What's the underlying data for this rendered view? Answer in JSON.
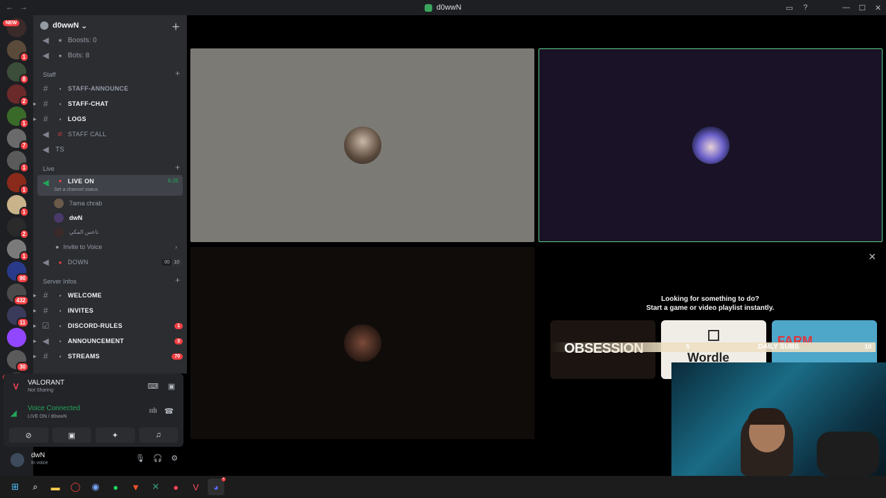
{
  "window": {
    "title": "d0wwN"
  },
  "guild_badges": [
    {
      "badge": "NEW",
      "new": true,
      "color": "#3a2a2a"
    },
    {
      "badge": "1",
      "color": "#5a4a3a"
    },
    {
      "badge": "8",
      "color": "#3c4d3a"
    },
    {
      "badge": "2",
      "color": "#6a2a2a"
    },
    {
      "badge": "1",
      "color": "#3a6a2a"
    },
    {
      "badge": "7",
      "color": "#6a6a6a"
    },
    {
      "badge": "1",
      "color": "#5a5a5a"
    },
    {
      "badge": "1",
      "color": "#8a2a1a"
    },
    {
      "badge": "1",
      "color": "#c9b38a"
    },
    {
      "badge": "2",
      "color": "#2a2a2a"
    },
    {
      "badge": "1",
      "color": "#7a7a7a"
    },
    {
      "badge": "90",
      "color": "#2a3a8a"
    },
    {
      "badge": "432",
      "color": "#4a4a4a"
    },
    {
      "badge": "11",
      "color": "#3a3a5a"
    },
    {
      "badge": "",
      "color": "#9146ff"
    },
    {
      "badge": "30",
      "color": "#5a5a5a"
    },
    {
      "badge": "NEW",
      "new": true,
      "color": "#3a3a3a"
    }
  ],
  "server": {
    "name": "d0wwN"
  },
  "channels": {
    "boosts": "Boosts: 0",
    "bots": "Bots: 8",
    "cat_staff": "Staff",
    "staff_announce": "STAFF-ANNOUNCE",
    "staff_chat": "STAFF-CHAT",
    "logs": "LOGS",
    "staff_call": "STAFF CALL",
    "ts": "TS",
    "cat_live": "Live",
    "live_on": "LIVE ON",
    "live_time": "6:35",
    "live_status": "Set a channel status",
    "user1": "7ama chrab",
    "user2": "dwN",
    "user3": "ناعس المكي",
    "invite": "Invite to Voice",
    "down": "DOWN",
    "down_limit_a": "00",
    "down_limit_b": "10",
    "cat_infos": "Server Infos",
    "welcome": "WELCOME",
    "invites": "INVITES",
    "rules": "DISCORD-RULES",
    "rules_count": "1",
    "announce": "ANNOUNCEMENT",
    "announce_count": "3",
    "streams": "STREAMS",
    "streams_count": "70"
  },
  "activity_panel": {
    "game": "VALORANT",
    "sub": "Not Sharing"
  },
  "voice": {
    "status": "Voice Connected",
    "channel": "LIVE ON / d0wwN"
  },
  "user": {
    "name": "dwN",
    "status": "In voice"
  },
  "stage": {
    "activity_h1": "Looking for something to do?",
    "activity_h2": "Start a game or video playlist instantly.",
    "card1": "OBSESSION",
    "card2": "Wordle",
    "card3": "FARM",
    "banner_left": "5",
    "banner_mid": "DAILY SUBS",
    "banner_right": "10"
  },
  "colors": {
    "accent": "#23a55a",
    "danger": "#f23f43",
    "speaking_border": "#5dd68a"
  }
}
